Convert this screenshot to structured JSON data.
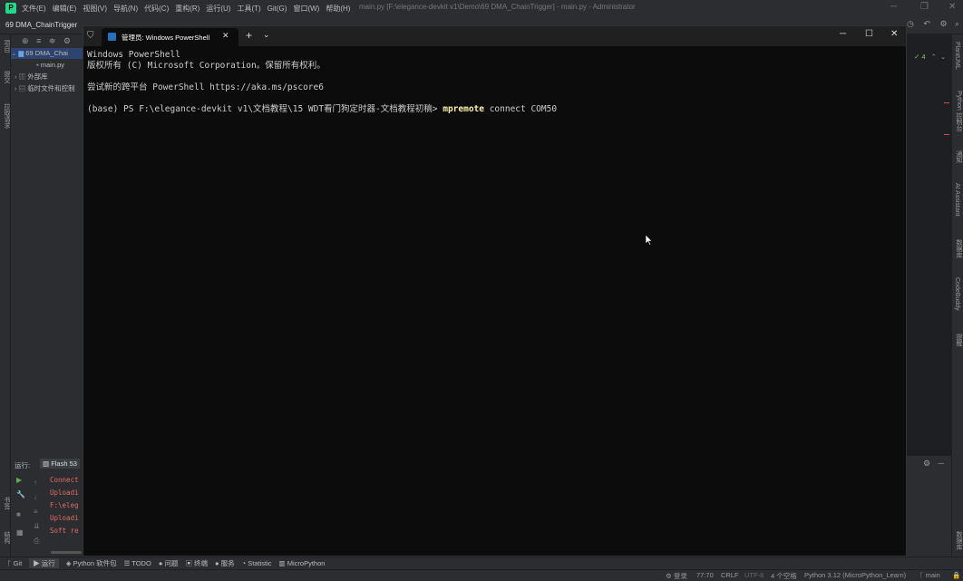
{
  "ide": {
    "menu": [
      "文件(E)",
      "编辑(E)",
      "视图(V)",
      "导航(N)",
      "代码(C)",
      "重构(R)",
      "运行(U)",
      "工具(T)",
      "Git(G)",
      "窗口(W)",
      "帮助(H)"
    ],
    "title": "main.py [F:\\elegance-devkit v1\\Demo\\69 DMA_ChainTrigger] - main.py - Administrator",
    "project_name": "69 DMA_ChainTrigger",
    "tree": {
      "root": "69 DMA_Chai",
      "file": "main.py",
      "external": "外部库",
      "scratch": "临时文件和控制"
    },
    "run_panel": {
      "label": "运行:",
      "tab": "Flash 53",
      "lines": [
        "Connect",
        "Uploadi",
        "F:\\eleg",
        "Uploadi",
        "Soft re"
      ]
    },
    "bottom_tabs": [
      "Git",
      "运行",
      "Python 软件包",
      "TODO",
      "问题",
      "终端",
      "服务",
      "Statistic",
      "MicroPython"
    ],
    "status": {
      "login": "登录",
      "position": "77:70",
      "line_ending": "CRLF",
      "encoding": "UTF-8",
      "indent": "4 个空格",
      "interpreter": "Python 3.12 (MicroPython_Learn)",
      "branch": "main"
    },
    "right_stripe": [
      "PlantUML",
      "Python 控制台",
      "通知",
      "AI Assistant",
      "数据库",
      "CodeBuddy",
      "提醒",
      "数据库"
    ],
    "left_stripe": [
      "项目",
      "提交",
      "拉取请求",
      "书签",
      "结构"
    ],
    "inspection_count": "4"
  },
  "terminal": {
    "tab_title": "管理员: Windows PowerShell",
    "lines": {
      "l1": "Windows PowerShell",
      "l2": "版权所有 (C) Microsoft Corporation。保留所有权利。",
      "l3": "尝试新的跨平台 PowerShell https://aka.ms/pscore6",
      "prompt": "(base) PS F:\\elegance-devkit v1\\文档教程\\15 WDT看门狗定时器-文档教程初稿> ",
      "command": "mpremote",
      "args": " connect COM50"
    }
  }
}
